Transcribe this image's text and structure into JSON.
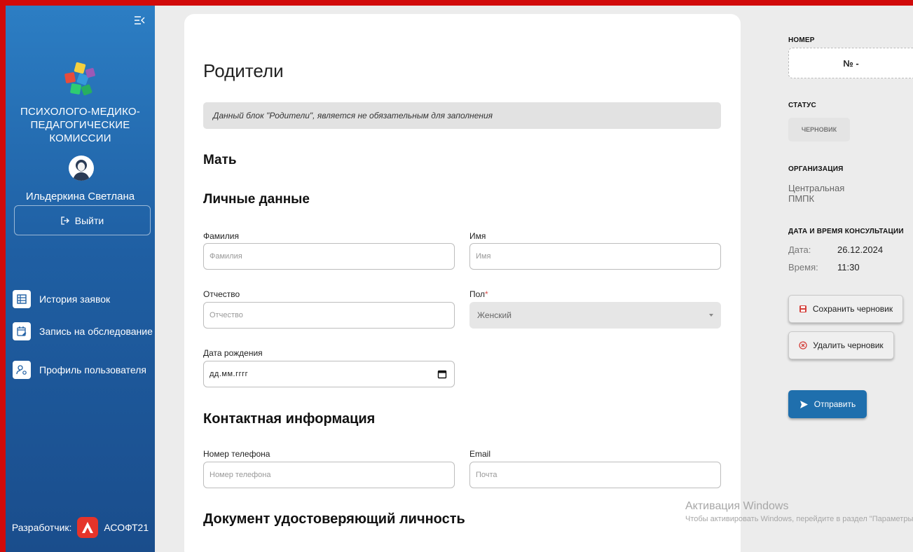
{
  "sidebar": {
    "org_name_line1": "ПСИХОЛОГО-МЕДИКО-",
    "org_name_line2": "ПЕДАГОГИЧЕСКИЕ КОМИССИИ",
    "user_name": "Ильдеркина Светлана",
    "logout_label": "Выйти",
    "nav": [
      {
        "label": "История заявок",
        "icon": "table-icon"
      },
      {
        "label": "Запись на обследование",
        "icon": "calendar-edit-icon"
      },
      {
        "label": "Профиль пользователя",
        "icon": "user-settings-icon"
      }
    ],
    "developer_label": "Разработчик:",
    "developer_name": "АСОФТ21"
  },
  "main": {
    "title": "Родители",
    "notice": "Данный блок \"Родители\", является не обязательным для заполнения",
    "mother_heading": "Мать",
    "personal_heading": "Личные данные",
    "fields": {
      "last_name": {
        "label": "Фамилия",
        "placeholder": "Фамилия"
      },
      "first_name": {
        "label": "Имя",
        "placeholder": "Имя"
      },
      "patronymic": {
        "label": "Отчество",
        "placeholder": "Отчество"
      },
      "gender": {
        "label": "Пол",
        "required_mark": "*",
        "value": "Женский"
      },
      "birth_date": {
        "label": "Дата рождения",
        "placeholder": "дд.мм.гггг"
      },
      "phone": {
        "label": "Номер телефона",
        "placeholder": "Номер телефона"
      },
      "email": {
        "label": "Email",
        "placeholder": "Почта"
      }
    },
    "contact_heading": "Контактная информация",
    "document_heading": "Документ удостоверяющий личность"
  },
  "right_panel": {
    "number_title": "НОМЕР",
    "number_value": "№ -",
    "status_title": "СТАТУС",
    "status_value": "ЧЕРНОВИК",
    "org_title": "ОРГАНИЗАЦИЯ",
    "org_value": "Центральная ПМПК",
    "consult_title": "ДАТА И ВРЕМЯ КОНСУЛЬТАЦИИ",
    "date_label": "Дата:",
    "date_value": "26.12.2024",
    "time_label": "Время:",
    "time_value": "11:30",
    "save_draft_label": "Сохранить черновик",
    "delete_draft_label": "Удалить черновик",
    "send_label": "Отправить"
  },
  "watermark": {
    "title": "Активация Windows",
    "subtitle": "Чтобы активировать Windows, перейдите в раздел \"Параметры\"."
  },
  "colors": {
    "sidebar": "#2c7ec4",
    "frame": "#d10a0a",
    "primary_button": "#1f6fad",
    "developer_logo": "#e5342a"
  }
}
